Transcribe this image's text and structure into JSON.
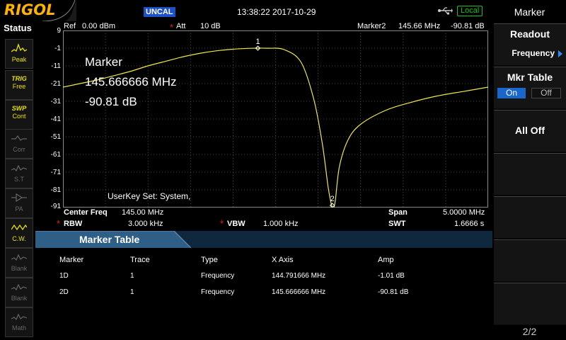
{
  "topbar": {
    "logo": "RIGOL",
    "uncal": "UNCAL",
    "datetime": "13:38:22 2017-10-29",
    "local": "Local"
  },
  "status": {
    "title": "Status",
    "buttons": [
      {
        "top": "",
        "label": "Peak",
        "state": "on"
      },
      {
        "top": "TRIG",
        "label": "Free",
        "state": "on"
      },
      {
        "top": "SWP",
        "label": "Cont",
        "state": "on"
      },
      {
        "top": "",
        "label": "Corr",
        "state": "off"
      },
      {
        "top": "",
        "label": "S.T",
        "state": "off"
      },
      {
        "top": "",
        "label": "PA",
        "state": "off"
      },
      {
        "top": "",
        "label": "C.W.",
        "state": "on"
      },
      {
        "top": "",
        "label": "Blank",
        "state": "off"
      },
      {
        "top": "",
        "label": "Blank",
        "state": "off"
      },
      {
        "top": "",
        "label": "Math",
        "state": "off"
      }
    ]
  },
  "plot": {
    "ref_label": "Ref",
    "ref_value": "0.00 dBm",
    "att_label": "Att",
    "att_value": "10 dB",
    "marker_label": "Marker2",
    "marker_freq": "145.66 MHz",
    "marker_amp": "-90.81 dB",
    "yticks": [
      "-1",
      "-11",
      "-21",
      "-31",
      "-41",
      "-51",
      "-61",
      "-71",
      "-81",
      "-91"
    ],
    "top_tick": "9",
    "overlay": {
      "title": "Marker",
      "freq": "145.666666 MHz",
      "amp": "-90.81 dB"
    },
    "userkey": "UserKey Set:   System,",
    "marker1_label": "1",
    "marker2_label": "2",
    "trace_color": "#f0e84a"
  },
  "chart_data": {
    "type": "line",
    "x_range_mhz": [
      142.5,
      147.5
    ],
    "ylim": [
      -91,
      9
    ],
    "series": [
      {
        "points": [
          [
            142.5,
            -23
          ],
          [
            142.7,
            -21
          ],
          [
            142.9,
            -19
          ],
          [
            143.1,
            -16.5
          ],
          [
            143.3,
            -14
          ],
          [
            143.5,
            -11
          ],
          [
            143.7,
            -8.5
          ],
          [
            143.9,
            -6
          ],
          [
            144.1,
            -4
          ],
          [
            144.3,
            -2.5
          ],
          [
            144.5,
            -1.6
          ],
          [
            144.7,
            -1.1
          ],
          [
            144.79,
            -1.01
          ],
          [
            144.9,
            -1.05
          ],
          [
            145.1,
            -1.8
          ],
          [
            145.3,
            -9
          ],
          [
            145.45,
            -30
          ],
          [
            145.55,
            -55
          ],
          [
            145.62,
            -80
          ],
          [
            145.667,
            -90.81
          ],
          [
            145.7,
            -88
          ],
          [
            145.75,
            -68
          ],
          [
            145.85,
            -53
          ],
          [
            146.0,
            -44
          ],
          [
            146.3,
            -36
          ],
          [
            146.6,
            -31.5
          ],
          [
            146.9,
            -28
          ],
          [
            147.2,
            -25.5
          ],
          [
            147.5,
            -23
          ]
        ]
      }
    ],
    "markers": [
      {
        "id": "1D",
        "x": 144.791666,
        "y": -1.01
      },
      {
        "id": "2D",
        "x": 145.666666,
        "y": -90.81
      }
    ]
  },
  "bottom_info": {
    "center_label": "Center Freq",
    "center_value": "145.00 MHz",
    "span_label": "Span",
    "span_value": "5.0000 MHz",
    "rbw_label": "RBW",
    "rbw_value": "3.000 kHz",
    "vbw_label": "VBW",
    "vbw_value": "1.000 kHz",
    "swt_label": "SWT",
    "swt_value": "1.6666 s"
  },
  "marker_table": {
    "title": "Marker Table",
    "columns": [
      "Marker",
      "Trace",
      "Type",
      "X Axis",
      "Amp"
    ],
    "rows": [
      [
        "1D",
        "1",
        "Frequency",
        "144.791666 MHz",
        "-1.01 dB"
      ],
      [
        "2D",
        "1",
        "Frequency",
        "145.666666 MHz",
        "-90.81 dB"
      ]
    ]
  },
  "menu": {
    "title": "Marker",
    "readout_label": "Readout",
    "readout_value": "Frequency",
    "mkr_table_label": "Mkr Table",
    "on_label": "On",
    "off_label": "Off",
    "all_off_label": "All Off",
    "page": "2/2"
  }
}
